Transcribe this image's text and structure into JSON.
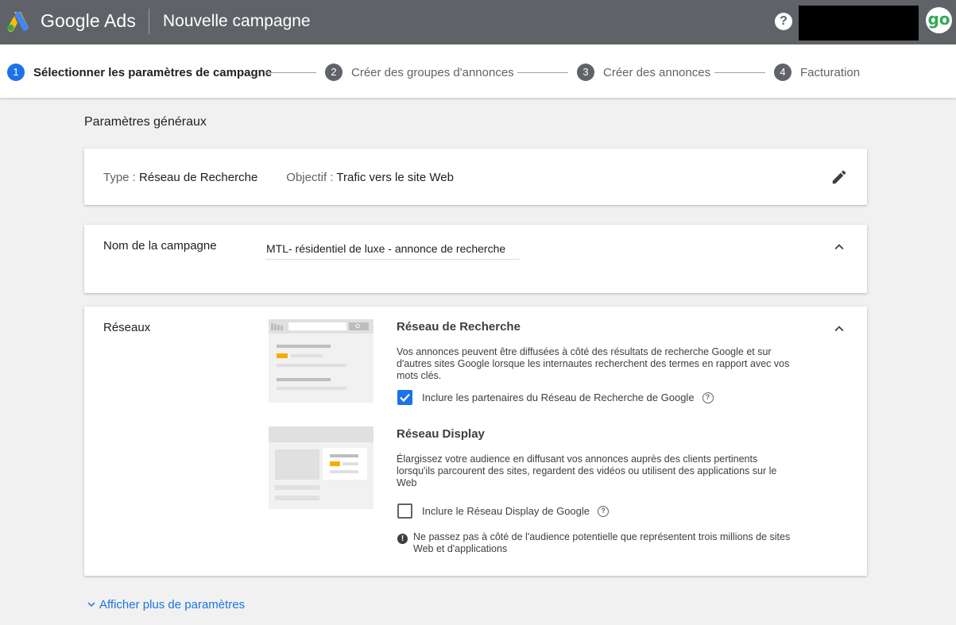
{
  "header": {
    "brand": "Google Ads",
    "title": "Nouvelle campagne",
    "help_icon": "help-icon",
    "avatar_text": "go"
  },
  "stepper": {
    "steps": [
      {
        "num": "1",
        "label": "Sélectionner les paramètres de campagne",
        "active": true
      },
      {
        "num": "2",
        "label": "Créer des groupes d'annonces",
        "active": false
      },
      {
        "num": "3",
        "label": "Créer des annonces",
        "active": false
      },
      {
        "num": "4",
        "label": "Facturation",
        "active": false
      }
    ]
  },
  "section": {
    "heading": "Paramètres généraux"
  },
  "type_card": {
    "type_label": "Type :",
    "type_value": "Réseau de Recherche",
    "goal_label": "Objectif :",
    "goal_value": "Trafic vers le site Web",
    "edit_icon": "pencil-icon"
  },
  "name_card": {
    "label": "Nom de la campagne",
    "value": "MTL- résidentiel de luxe - annonce de recherche"
  },
  "networks_card": {
    "label": "Réseaux",
    "search": {
      "title": "Réseau de Recherche",
      "description": "Vos annonces peuvent être diffusées à côté des résultats de recherche Google et sur d'autres sites Google lorsque les internautes recherchent des termes en rapport avec vos mots clés.",
      "checkbox_label": "Inclure les partenaires du Réseau de Recherche de Google",
      "checked": true
    },
    "display": {
      "title": "Réseau Display",
      "description": "Élargissez votre audience en diffusant vos annonces auprès des clients pertinents lorsqu'ils parcourent des sites, regardent des vidéos ou utilisent des applications sur le Web",
      "checkbox_label": "Inclure le Réseau Display de Google",
      "checked": false,
      "note": "Ne passez pas à côté de l'audience potentielle que représentent trois millions de sites Web et d'applications"
    }
  },
  "footer": {
    "more_label": "Afficher plus de paramètres"
  },
  "colors": {
    "header_bg": "#5f6368",
    "accent": "#1a73e8",
    "illustration_highlight": "#f9ab00"
  }
}
